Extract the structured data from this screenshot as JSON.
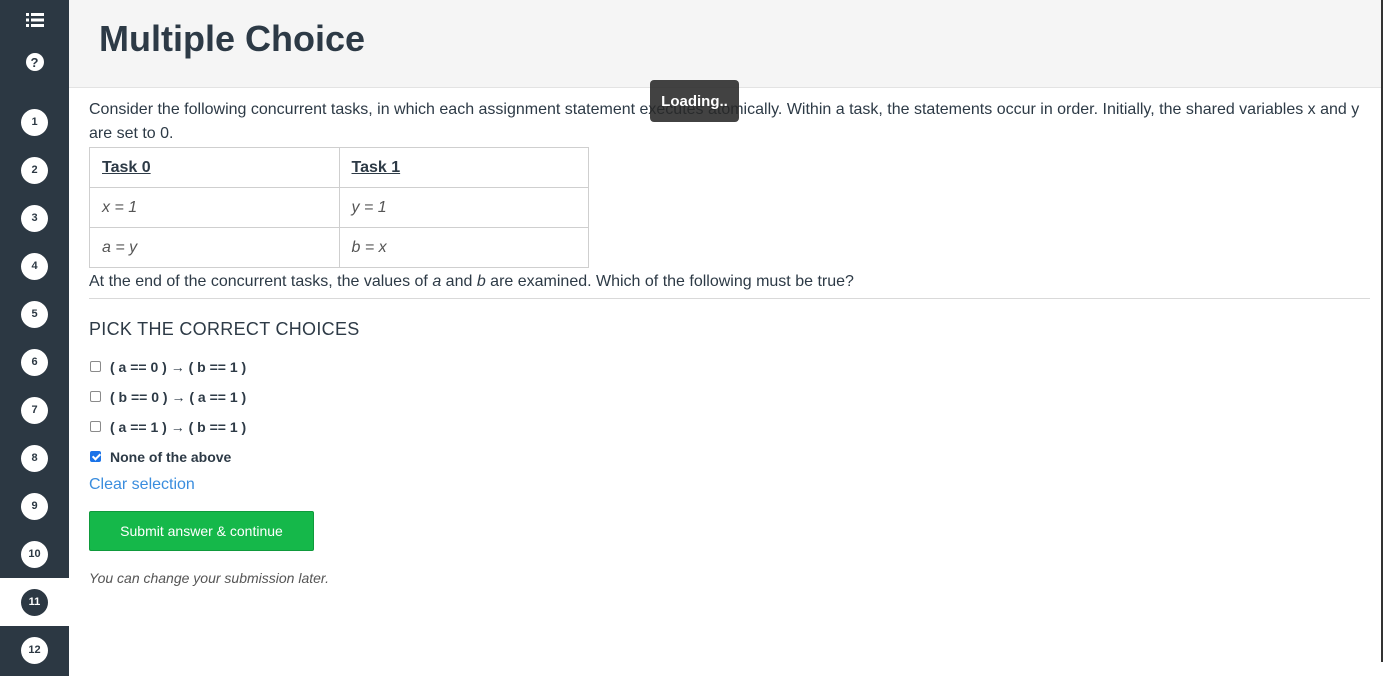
{
  "header": {
    "title": "Multiple Choice"
  },
  "sidebar": {
    "icons": [
      "list-icon",
      "help-icon"
    ],
    "help_symbol": "?",
    "questions": [
      "1",
      "2",
      "3",
      "4",
      "5",
      "6",
      "7",
      "8",
      "9",
      "10",
      "11",
      "12"
    ],
    "active_question": "11"
  },
  "loading": {
    "label": "Loading.."
  },
  "question": {
    "intro": "Consider the following concurrent tasks, in which each assignment statement executes atomically. Within a task, the statements occur in order. Initially, the shared variables x and y are set to 0.",
    "table": {
      "headers": [
        "Task 0",
        "Task 1"
      ],
      "rows": [
        [
          "x = 1",
          "y = 1"
        ],
        [
          "a = y",
          "b = x"
        ]
      ]
    },
    "end_pre": "At the end of the concurrent tasks, the values of ",
    "end_a": "a",
    "end_and": " and ",
    "end_b": "b",
    "end_post": " are examined. Which of the following must be true?"
  },
  "choices": {
    "heading": "PICK THE CORRECT CHOICES",
    "options": [
      {
        "label": "( a == 0 ) → ( b == 1 )",
        "checked": false
      },
      {
        "label": "( b == 0 ) → ( a == 1 )",
        "checked": false
      },
      {
        "label": "( a == 1 ) → ( b == 1 )",
        "checked": false
      },
      {
        "label": "None of the above",
        "checked": true
      }
    ],
    "clear_label": "Clear selection",
    "submit_label": "Submit answer & continue",
    "note": "You can change your submission later."
  },
  "colors": {
    "sidebar": "#2c3843",
    "submit": "#15b84a",
    "link": "#3a8dde",
    "checkbox": "#1a73e8"
  }
}
